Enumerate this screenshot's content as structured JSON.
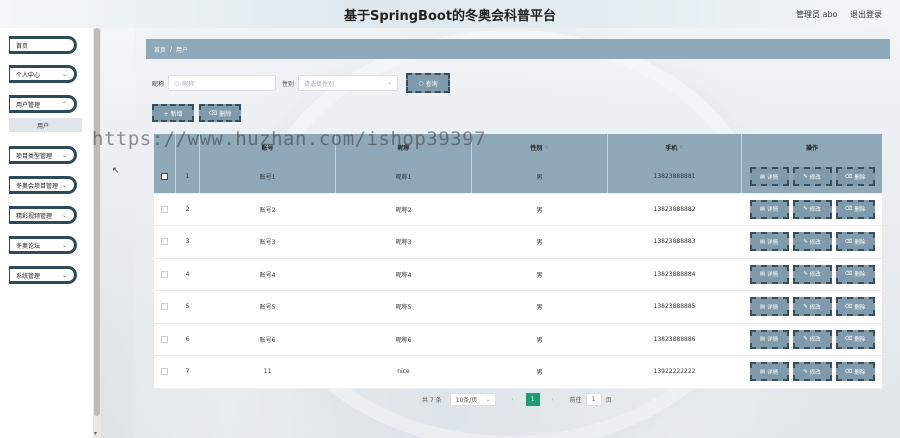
{
  "header": {
    "title": "基于SpringBoot的冬奥会科普平台",
    "admin": "管理员 abo",
    "logout": "退出登录"
  },
  "sidebar": {
    "items": [
      {
        "label": "首页",
        "has_chevron": false
      },
      {
        "label": "个人中心",
        "has_chevron": true
      },
      {
        "label": "用户管理",
        "has_chevron": true
      },
      {
        "label": "项目类型管理",
        "has_chevron": true
      },
      {
        "label": "冬奥会项目管理",
        "has_chevron": true
      },
      {
        "label": "精彩视频管理",
        "has_chevron": true
      },
      {
        "label": "冬奥论坛",
        "has_chevron": true
      },
      {
        "label": "系统管理",
        "has_chevron": true
      }
    ],
    "sub_item": "用户"
  },
  "breadcrumb": {
    "home": "首页",
    "sep": "/",
    "current": "用户"
  },
  "search": {
    "nickname_label": "昵称",
    "nickname_placeholder": "昵称",
    "gender_label": "性别",
    "gender_placeholder": "请选择性别",
    "search_button": "查询"
  },
  "actions": {
    "add": "+ 新增",
    "delete": "删除"
  },
  "table": {
    "headers": [
      "",
      "",
      "账号",
      "昵称",
      "性别",
      "手机",
      "操作"
    ],
    "rows": [
      {
        "idx": "1",
        "account": "账号1",
        "nickname": "昵称1",
        "gender": "男",
        "phone": "13823888881"
      },
      {
        "idx": "2",
        "account": "账号2",
        "nickname": "昵称2",
        "gender": "男",
        "phone": "13823888882"
      },
      {
        "idx": "3",
        "account": "账号3",
        "nickname": "昵称3",
        "gender": "男",
        "phone": "13823888883"
      },
      {
        "idx": "4",
        "account": "账号4",
        "nickname": "昵称4",
        "gender": "男",
        "phone": "13823888884"
      },
      {
        "idx": "5",
        "account": "账号5",
        "nickname": "昵称5",
        "gender": "男",
        "phone": "13823888885"
      },
      {
        "idx": "6",
        "account": "账号6",
        "nickname": "昵称6",
        "gender": "男",
        "phone": "13823888886"
      },
      {
        "idx": "7",
        "account": "11",
        "nickname": "nice",
        "gender": "男",
        "phone": "13922222222"
      }
    ],
    "ops": {
      "detail": "详情",
      "edit": "修改",
      "delete": "删除"
    }
  },
  "pagination": {
    "total": "共 7 条",
    "page_size": "10条/页",
    "current": "1",
    "goto_label": "前往",
    "goto_value": "1",
    "page_suffix": "页"
  },
  "watermark": "https://www.huzhan.com/ishop39397",
  "colors": {
    "accent": "#8fa9b8",
    "border_dark": "#2d4a5b",
    "page_active": "#1e9d72"
  }
}
